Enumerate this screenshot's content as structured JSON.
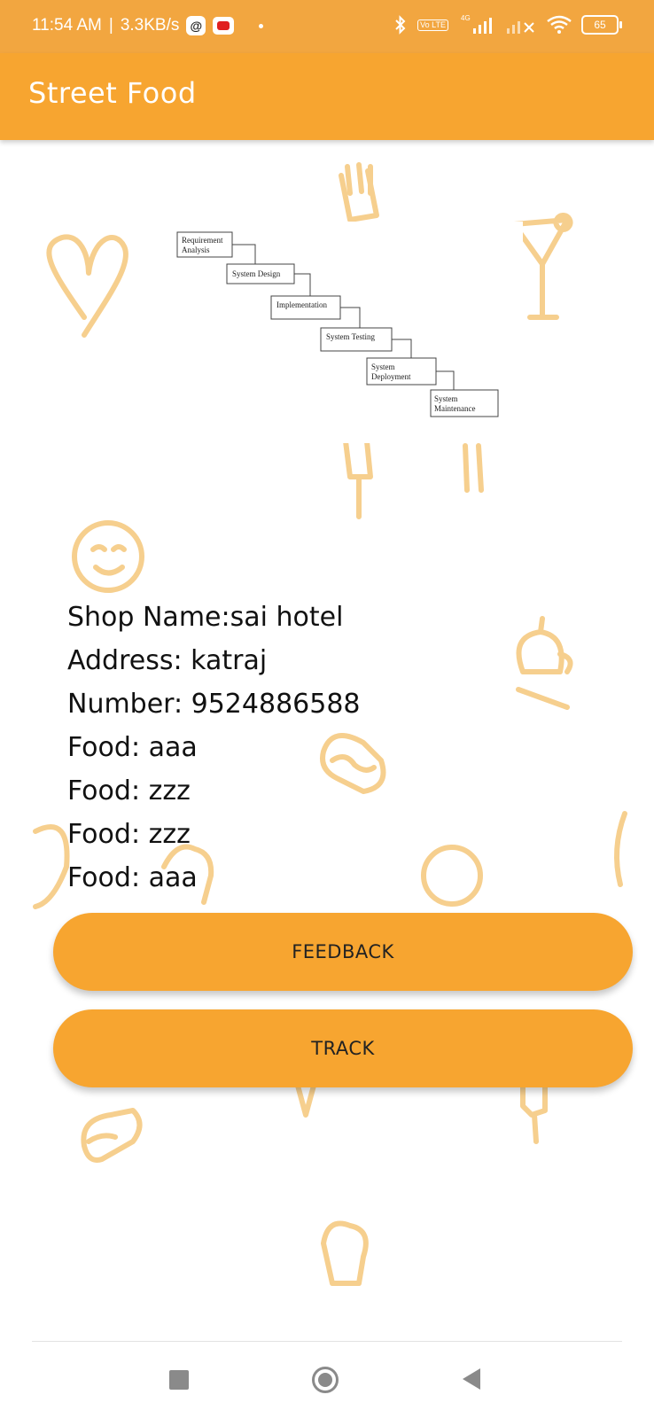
{
  "status_bar": {
    "time": "11:54 AM",
    "speed": "3.3KB/s",
    "battery": "65",
    "network_badge": "4G",
    "lte_badge": "Vo LTE",
    "icons": [
      "threads-icon",
      "youtube-icon",
      "bluetooth-icon",
      "signal-icon",
      "wifi-icon",
      "battery-icon"
    ]
  },
  "app_bar": {
    "title": "Street Food"
  },
  "diagram": {
    "steps": [
      "Requirement Analysis",
      "System Design",
      "Implementation",
      "System Testing",
      "System Deployment",
      "System Maintenance"
    ]
  },
  "shop": {
    "name_line": "Shop Name:sai hotel",
    "address_line": "Address: katraj",
    "number_line": "Number: 9524886588",
    "foods": [
      "Food: aaa",
      "Food: zzz",
      "Food: zzz",
      "Food: aaa"
    ]
  },
  "buttons": {
    "feedback": "FEEDBACK",
    "track": "TRACK"
  },
  "nav": {
    "icons": [
      "recent-apps-icon",
      "home-icon",
      "back-icon"
    ]
  },
  "colors": {
    "primary": "#f7a530",
    "status_bar": "#f2a640",
    "deco": "#f6cf8e"
  }
}
